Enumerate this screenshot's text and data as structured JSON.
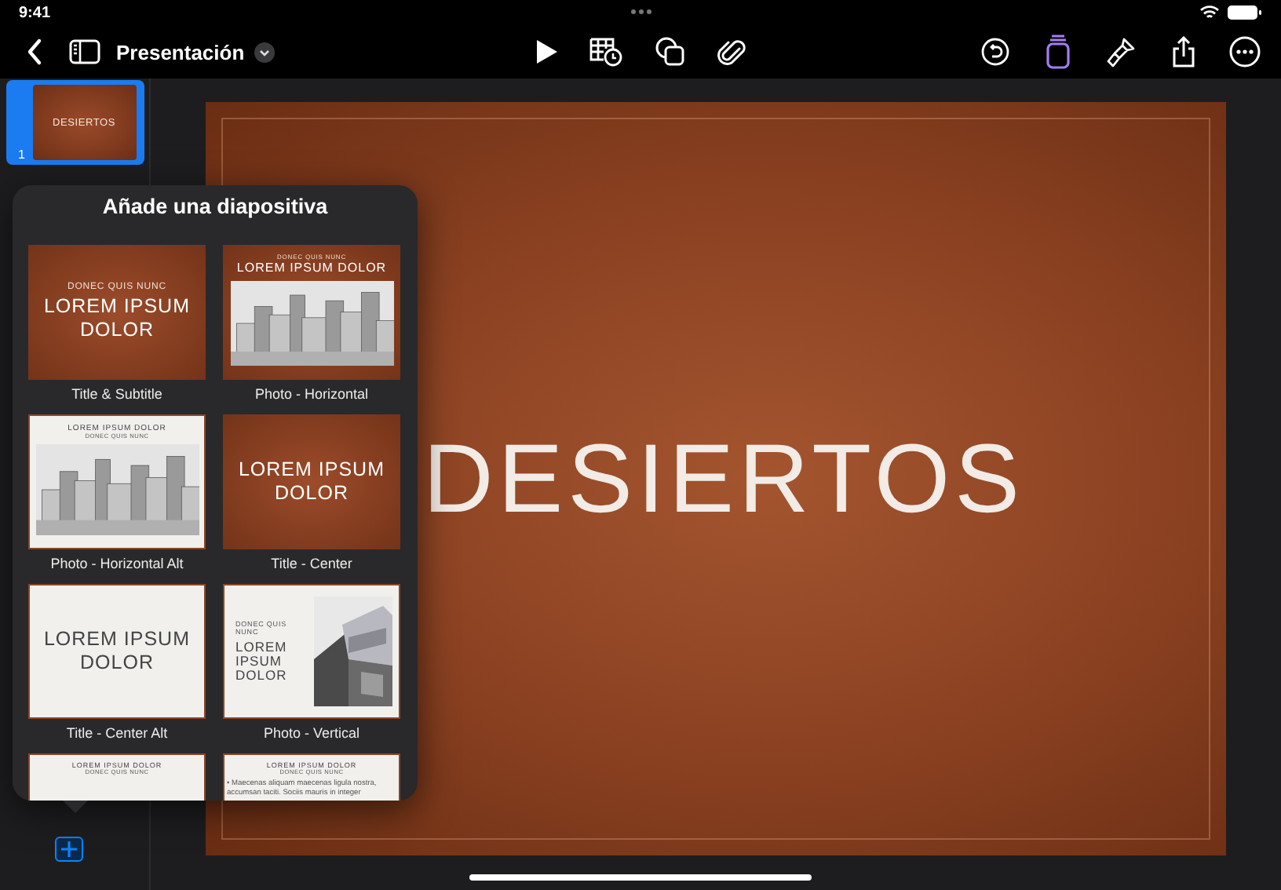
{
  "status_bar": {
    "time": "9:41"
  },
  "toolbar": {
    "title": "Presentación",
    "tools": [
      {
        "kind": "play",
        "selected": false
      },
      {
        "kind": "table",
        "selected": false
      },
      {
        "kind": "shapes",
        "selected": false
      },
      {
        "kind": "attach",
        "selected": false
      },
      {
        "kind": "undo",
        "selected": false
      },
      {
        "kind": "format",
        "selected": true
      },
      {
        "kind": "brush",
        "selected": false
      },
      {
        "kind": "share",
        "selected": false
      },
      {
        "kind": "more",
        "selected": false
      }
    ]
  },
  "slides": [
    {
      "number": "1",
      "title": "DESIERTOS",
      "selected": true
    }
  ],
  "canvas": {
    "title": "DESIERTOS"
  },
  "popover": {
    "title": "Añade una diapositiva",
    "layouts": [
      {
        "kind": "title-subtitle",
        "light": false,
        "kicker": "DONEC QUIS NUNC",
        "title": "LOREM IPSUM DOLOR",
        "label": "Title & Subtitle"
      },
      {
        "kind": "photo-horizontal",
        "light": false,
        "kicker": "DONEC QUIS NUNC",
        "title": "LOREM IPSUM DOLOR",
        "label": "Photo - Horizontal"
      },
      {
        "kind": "photo-horizontal-alt",
        "light": true,
        "title": "LOREM IPSUM DOLOR",
        "subtitle": "DONEC QUIS NUNC",
        "label": "Photo - Horizontal Alt"
      },
      {
        "kind": "title-center",
        "light": false,
        "title": "LOREM IPSUM DOLOR",
        "label": "Title - Center"
      },
      {
        "kind": "title-center-alt",
        "light": true,
        "title": "LOREM IPSUM DOLOR",
        "label": "Title - Center Alt"
      },
      {
        "kind": "photo-vertical",
        "light": true,
        "kicker": "DONEC QUIS NUNC",
        "title": "LOREM IPSUM DOLOR",
        "label": "Photo - Vertical"
      },
      {
        "kind": "title-top",
        "light": true,
        "title": "LOREM IPSUM DOLOR",
        "subtitle": "DONEC QUIS NUNC"
      },
      {
        "kind": "bullets",
        "light": true,
        "title": "LOREM IPSUM DOLOR",
        "subtitle": "DONEC QUIS NUNC",
        "body": "• Maecenas aliquam maecenas ligula nostra, accumsan taciti. Sociis mauris in integer"
      }
    ]
  }
}
